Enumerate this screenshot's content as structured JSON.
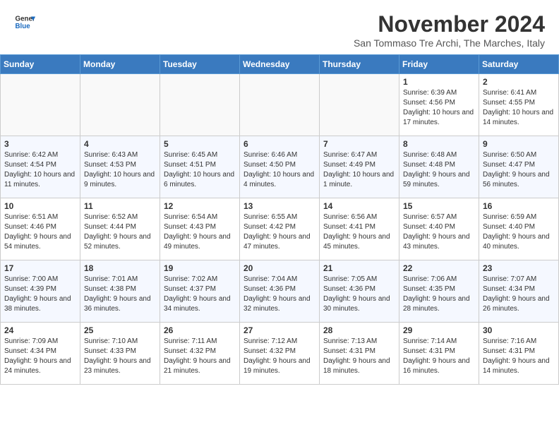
{
  "header": {
    "logo_line1": "General",
    "logo_line2": "Blue",
    "month_title": "November 2024",
    "subtitle": "San Tommaso Tre Archi, The Marches, Italy"
  },
  "weekdays": [
    "Sunday",
    "Monday",
    "Tuesday",
    "Wednesday",
    "Thursday",
    "Friday",
    "Saturday"
  ],
  "weeks": [
    [
      {
        "day": "",
        "info": ""
      },
      {
        "day": "",
        "info": ""
      },
      {
        "day": "",
        "info": ""
      },
      {
        "day": "",
        "info": ""
      },
      {
        "day": "",
        "info": ""
      },
      {
        "day": "1",
        "info": "Sunrise: 6:39 AM\nSunset: 4:56 PM\nDaylight: 10 hours and 17 minutes."
      },
      {
        "day": "2",
        "info": "Sunrise: 6:41 AM\nSunset: 4:55 PM\nDaylight: 10 hours and 14 minutes."
      }
    ],
    [
      {
        "day": "3",
        "info": "Sunrise: 6:42 AM\nSunset: 4:54 PM\nDaylight: 10 hours and 11 minutes."
      },
      {
        "day": "4",
        "info": "Sunrise: 6:43 AM\nSunset: 4:53 PM\nDaylight: 10 hours and 9 minutes."
      },
      {
        "day": "5",
        "info": "Sunrise: 6:45 AM\nSunset: 4:51 PM\nDaylight: 10 hours and 6 minutes."
      },
      {
        "day": "6",
        "info": "Sunrise: 6:46 AM\nSunset: 4:50 PM\nDaylight: 10 hours and 4 minutes."
      },
      {
        "day": "7",
        "info": "Sunrise: 6:47 AM\nSunset: 4:49 PM\nDaylight: 10 hours and 1 minute."
      },
      {
        "day": "8",
        "info": "Sunrise: 6:48 AM\nSunset: 4:48 PM\nDaylight: 9 hours and 59 minutes."
      },
      {
        "day": "9",
        "info": "Sunrise: 6:50 AM\nSunset: 4:47 PM\nDaylight: 9 hours and 56 minutes."
      }
    ],
    [
      {
        "day": "10",
        "info": "Sunrise: 6:51 AM\nSunset: 4:46 PM\nDaylight: 9 hours and 54 minutes."
      },
      {
        "day": "11",
        "info": "Sunrise: 6:52 AM\nSunset: 4:44 PM\nDaylight: 9 hours and 52 minutes."
      },
      {
        "day": "12",
        "info": "Sunrise: 6:54 AM\nSunset: 4:43 PM\nDaylight: 9 hours and 49 minutes."
      },
      {
        "day": "13",
        "info": "Sunrise: 6:55 AM\nSunset: 4:42 PM\nDaylight: 9 hours and 47 minutes."
      },
      {
        "day": "14",
        "info": "Sunrise: 6:56 AM\nSunset: 4:41 PM\nDaylight: 9 hours and 45 minutes."
      },
      {
        "day": "15",
        "info": "Sunrise: 6:57 AM\nSunset: 4:40 PM\nDaylight: 9 hours and 43 minutes."
      },
      {
        "day": "16",
        "info": "Sunrise: 6:59 AM\nSunset: 4:40 PM\nDaylight: 9 hours and 40 minutes."
      }
    ],
    [
      {
        "day": "17",
        "info": "Sunrise: 7:00 AM\nSunset: 4:39 PM\nDaylight: 9 hours and 38 minutes."
      },
      {
        "day": "18",
        "info": "Sunrise: 7:01 AM\nSunset: 4:38 PM\nDaylight: 9 hours and 36 minutes."
      },
      {
        "day": "19",
        "info": "Sunrise: 7:02 AM\nSunset: 4:37 PM\nDaylight: 9 hours and 34 minutes."
      },
      {
        "day": "20",
        "info": "Sunrise: 7:04 AM\nSunset: 4:36 PM\nDaylight: 9 hours and 32 minutes."
      },
      {
        "day": "21",
        "info": "Sunrise: 7:05 AM\nSunset: 4:36 PM\nDaylight: 9 hours and 30 minutes."
      },
      {
        "day": "22",
        "info": "Sunrise: 7:06 AM\nSunset: 4:35 PM\nDaylight: 9 hours and 28 minutes."
      },
      {
        "day": "23",
        "info": "Sunrise: 7:07 AM\nSunset: 4:34 PM\nDaylight: 9 hours and 26 minutes."
      }
    ],
    [
      {
        "day": "24",
        "info": "Sunrise: 7:09 AM\nSunset: 4:34 PM\nDaylight: 9 hours and 24 minutes."
      },
      {
        "day": "25",
        "info": "Sunrise: 7:10 AM\nSunset: 4:33 PM\nDaylight: 9 hours and 23 minutes."
      },
      {
        "day": "26",
        "info": "Sunrise: 7:11 AM\nSunset: 4:32 PM\nDaylight: 9 hours and 21 minutes."
      },
      {
        "day": "27",
        "info": "Sunrise: 7:12 AM\nSunset: 4:32 PM\nDaylight: 9 hours and 19 minutes."
      },
      {
        "day": "28",
        "info": "Sunrise: 7:13 AM\nSunset: 4:31 PM\nDaylight: 9 hours and 18 minutes."
      },
      {
        "day": "29",
        "info": "Sunrise: 7:14 AM\nSunset: 4:31 PM\nDaylight: 9 hours and 16 minutes."
      },
      {
        "day": "30",
        "info": "Sunrise: 7:16 AM\nSunset: 4:31 PM\nDaylight: 9 hours and 14 minutes."
      }
    ]
  ]
}
